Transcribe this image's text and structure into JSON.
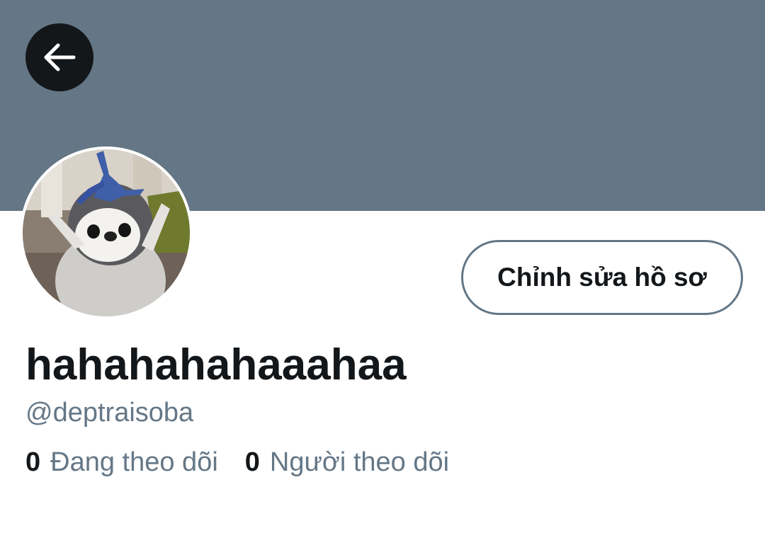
{
  "profile": {
    "display_name": "hahahahahaaahaa",
    "username": "@deptraisoba",
    "edit_button_label": "Chỉnh sửa hồ sơ",
    "banner_color": "#657786",
    "avatar_description_icon": "penguin-avatar-image"
  },
  "header": {
    "back_icon": "arrow-left-icon"
  },
  "stats": {
    "following": {
      "count": "0",
      "label": "Đang theo dõi"
    },
    "followers": {
      "count": "0",
      "label": "Người theo dõi"
    }
  }
}
